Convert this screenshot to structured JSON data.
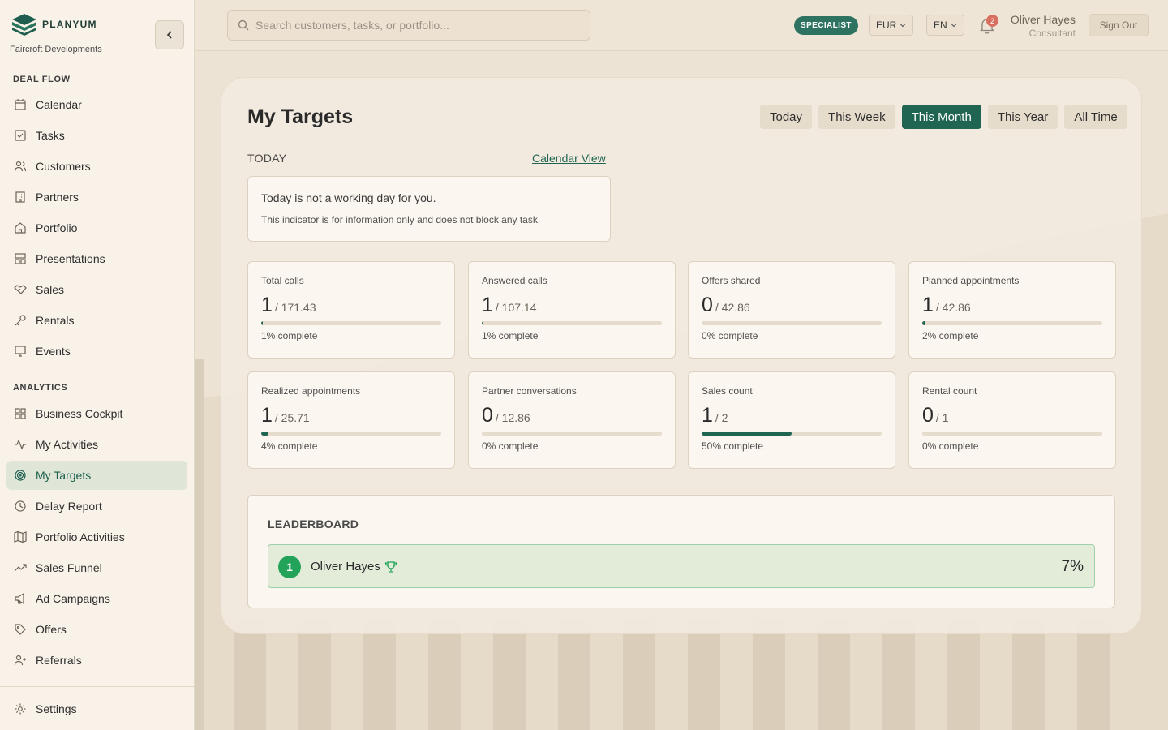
{
  "brand": {
    "name": "PLANYUM",
    "org": "Faircroft Developments"
  },
  "sidebar": {
    "section_deal_flow": "DEAL FLOW",
    "section_analytics": "ANALYTICS",
    "deal_flow": [
      {
        "label": "Calendar",
        "icon": "calendar-icon"
      },
      {
        "label": "Tasks",
        "icon": "tasks-icon"
      },
      {
        "label": "Customers",
        "icon": "users-icon"
      },
      {
        "label": "Partners",
        "icon": "building-icon"
      },
      {
        "label": "Portfolio",
        "icon": "home-icon"
      },
      {
        "label": "Presentations",
        "icon": "layout-icon"
      },
      {
        "label": "Sales",
        "icon": "handshake-icon"
      },
      {
        "label": "Rentals",
        "icon": "key-icon"
      },
      {
        "label": "Events",
        "icon": "monitor-icon"
      }
    ],
    "analytics": [
      {
        "label": "Business Cockpit",
        "icon": "grid-icon"
      },
      {
        "label": "My Activities",
        "icon": "activity-icon"
      },
      {
        "label": "My Targets",
        "icon": "target-icon",
        "active": true
      },
      {
        "label": "Delay Report",
        "icon": "clock-icon"
      },
      {
        "label": "Portfolio Activities",
        "icon": "map-icon"
      },
      {
        "label": "Sales Funnel",
        "icon": "trend-icon"
      },
      {
        "label": "Ad Campaigns",
        "icon": "megaphone-icon"
      },
      {
        "label": "Offers",
        "icon": "tag-icon"
      },
      {
        "label": "Referrals",
        "icon": "user-plus-icon"
      }
    ],
    "settings": {
      "label": "Settings",
      "icon": "gear-icon"
    }
  },
  "header": {
    "search_placeholder": "Search customers, tasks, or portfolio...",
    "role_badge": "SPECIALIST",
    "currency": "EUR",
    "language": "EN",
    "notification_count": "2",
    "user_name": "Oliver Hayes",
    "user_role": "Consultant",
    "sign_out": "Sign Out"
  },
  "main": {
    "title": "My Targets",
    "periods": [
      "Today",
      "This Week",
      "This Month",
      "This Year",
      "All Time"
    ],
    "active_period": "This Month",
    "today_label": "TODAY",
    "calendar_link": "Calendar View",
    "info_line1": "Today is not a working day for you.",
    "info_line2": "This indicator is for information only and does not block any task.",
    "metrics": [
      {
        "label": "Total calls",
        "value": "1",
        "target": "/ 171.43",
        "pct": 1,
        "complete": "1% complete"
      },
      {
        "label": "Answered calls",
        "value": "1",
        "target": "/ 107.14",
        "pct": 1,
        "complete": "1% complete"
      },
      {
        "label": "Offers shared",
        "value": "0",
        "target": "/ 42.86",
        "pct": 0,
        "complete": "0% complete"
      },
      {
        "label": "Planned appointments",
        "value": "1",
        "target": "/ 42.86",
        "pct": 2,
        "complete": "2% complete"
      },
      {
        "label": "Realized appointments",
        "value": "1",
        "target": "/ 25.71",
        "pct": 4,
        "complete": "4% complete"
      },
      {
        "label": "Partner conversations",
        "value": "0",
        "target": "/ 12.86",
        "pct": 0,
        "complete": "0% complete"
      },
      {
        "label": "Sales count",
        "value": "1",
        "target": "/ 2",
        "pct": 50,
        "complete": "50% complete"
      },
      {
        "label": "Rental count",
        "value": "0",
        "target": "/ 1",
        "pct": 0,
        "complete": "0% complete"
      }
    ],
    "leaderboard": {
      "title": "LEADERBOARD",
      "entries": [
        {
          "rank": "1",
          "name": "Oliver Hayes",
          "pct": "7%"
        }
      ]
    }
  },
  "colors": {
    "accent": "#1f6552",
    "leader_green": "#23a35a",
    "badge": "#2e7361"
  }
}
